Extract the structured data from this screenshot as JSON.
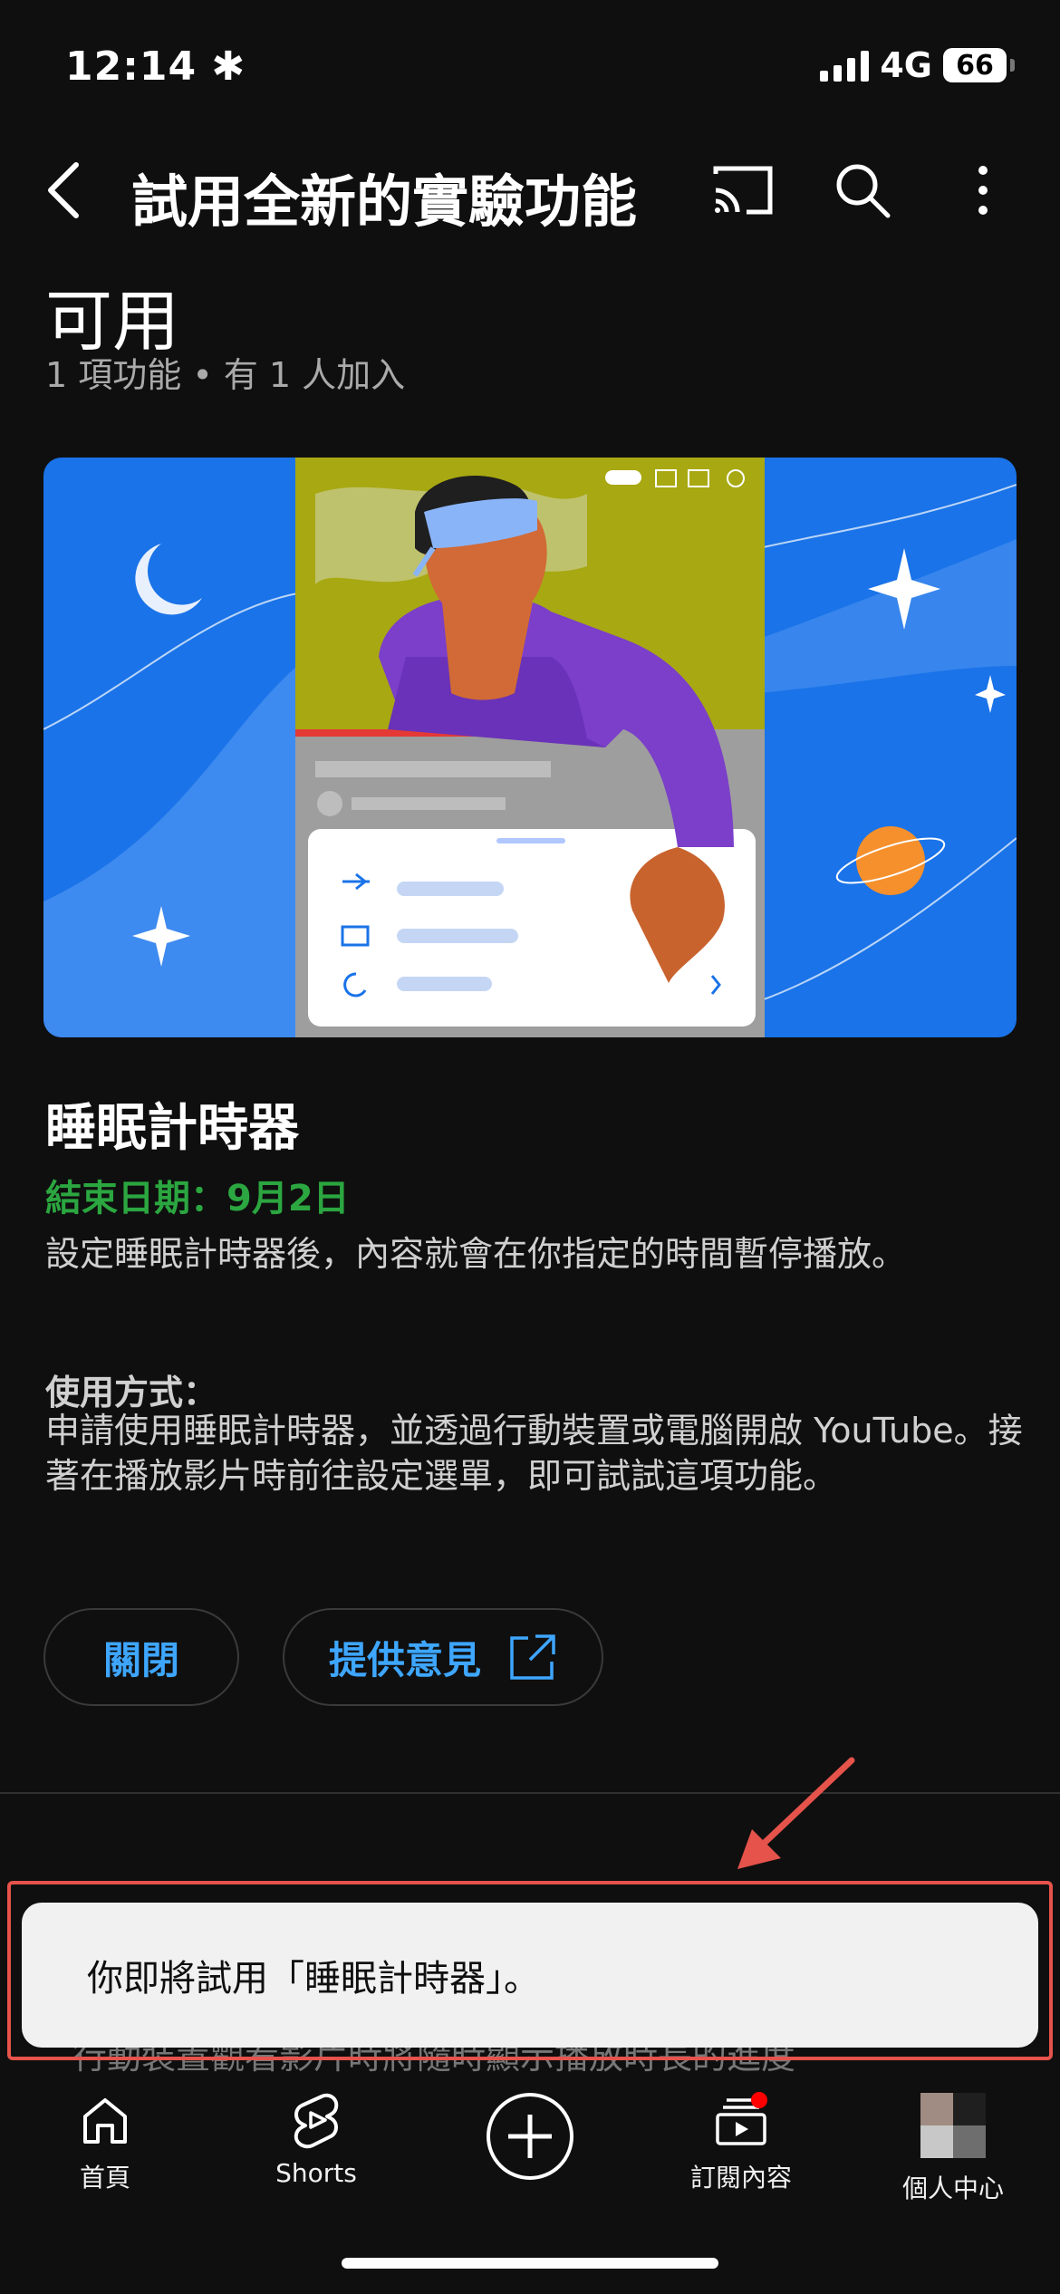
{
  "status_bar": {
    "time": "12:14 ✱",
    "network": "4G",
    "battery": "66"
  },
  "header": {
    "title": "試用全新的實驗功能"
  },
  "section": {
    "title": "可用",
    "subtitle": "1 項功能 • 有 1 人加入"
  },
  "feature": {
    "name": "睡眠計時器",
    "end_date": "結束日期：9月2日",
    "description": "設定睡眠計時器後，內容就會在你指定的時間暫停播放。",
    "howto_label": "使用方式：",
    "howto_text": "申請使用睡眠計時器，並透過行動裝置或電腦開啟 YouTube。接著在播放影片時前往設定選單，即可試試這項功能。"
  },
  "buttons": {
    "close": "關閉",
    "feedback": "提供意見"
  },
  "partial_text": "行動裝置觀看影片時將隨時顯示播放時長的進度",
  "toast": {
    "text": "你即將試用「睡眠計時器」。"
  },
  "nav": {
    "home": "首頁",
    "shorts": "Shorts",
    "subscriptions": "訂閱內容",
    "you": "個人中心"
  },
  "colors": {
    "accent_blue": "#3ea6ff",
    "green": "#2ba640",
    "annotation_red": "#e5534b",
    "background": "#0f0f0f"
  },
  "icons": [
    "back-icon",
    "cast-icon",
    "search-icon",
    "more-vert-icon",
    "external-link-icon",
    "home-icon",
    "shorts-icon",
    "add-icon",
    "subscriptions-icon"
  ]
}
